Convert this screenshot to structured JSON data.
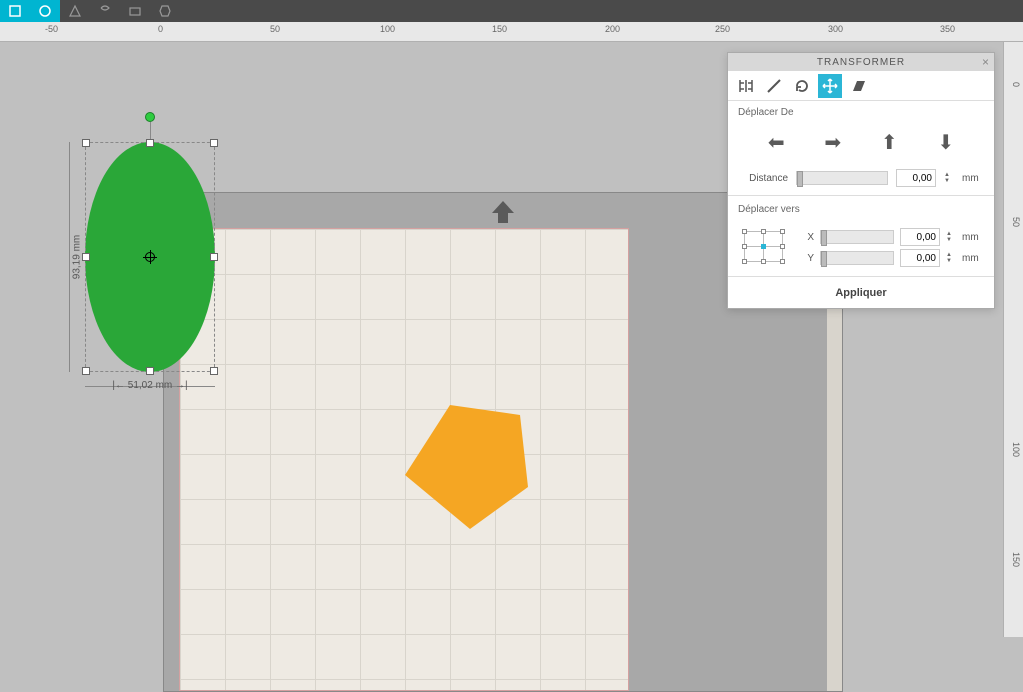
{
  "ruler_h": [
    "-50",
    "0",
    "50",
    "100",
    "150",
    "200",
    "250",
    "300",
    "350"
  ],
  "ruler_v": [
    "0",
    "50",
    "100",
    "150"
  ],
  "selection": {
    "width_label": "51,02 mm",
    "height_label": "93,19 mm"
  },
  "panel": {
    "title": "TRANSFORMER",
    "section1": "Déplacer De",
    "distance_label": "Distance",
    "distance_value": "0,00",
    "distance_unit": "mm",
    "section2": "Déplacer vers",
    "x_label": "X",
    "x_value": "0,00",
    "x_unit": "mm",
    "y_label": "Y",
    "y_value": "0,00",
    "y_unit": "mm",
    "apply": "Appliquer"
  }
}
